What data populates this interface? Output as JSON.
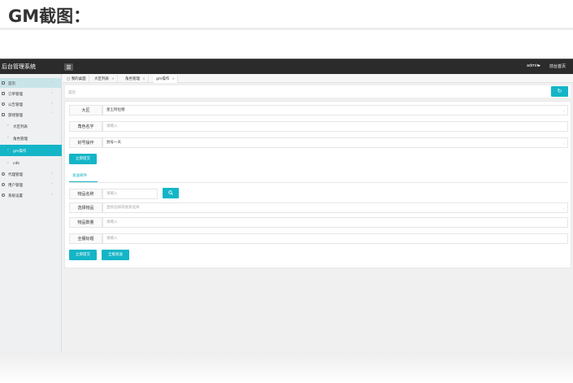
{
  "heading": "GM截图：",
  "app": {
    "brand": "后台管理系统",
    "user": "admin",
    "home_link": "前台首页"
  },
  "sidebar": {
    "items": [
      {
        "label": "首页",
        "icon": "home-icon"
      },
      {
        "label": "订单管理",
        "icon": "order-icon"
      },
      {
        "label": "公告管理",
        "icon": "notice-icon"
      },
      {
        "label": "游戏管理",
        "icon": "game-icon"
      },
      {
        "label": "大区列表"
      },
      {
        "label": "角色管理"
      },
      {
        "label": "gm操作"
      },
      {
        "label": "cdk"
      },
      {
        "label": "代理管理",
        "icon": "agent-icon"
      },
      {
        "label": "用户管理",
        "icon": "user-icon"
      },
      {
        "label": "系统设置",
        "icon": "settings-icon"
      }
    ]
  },
  "tabs": [
    {
      "label": "我的桌面"
    },
    {
      "label": "大区列表"
    },
    {
      "label": "角色管理"
    },
    {
      "label": "gm操作"
    }
  ],
  "breadcrumb": "首页",
  "form1": {
    "region_label": "大区",
    "region_value": "星尘阿拉德",
    "role_label": "角色名字",
    "role_placeholder": "请输入",
    "ban_label": "封号操作",
    "ban_value": "封号一天",
    "submit": "立即提交"
  },
  "mail_tab": "发送邮件",
  "form2": {
    "item_name_label": "物品名称",
    "item_name_placeholder": "请输入",
    "select_item_label": "选择物品",
    "select_item_placeholder": "直接选择或搜索选择",
    "qty_label": "物品数量",
    "qty_placeholder": "请输入",
    "title_label": "全服标题",
    "title_placeholder": "请输入",
    "submit": "立即提交",
    "send_all": "全服发送"
  },
  "colors": {
    "accent": "#14b5c7",
    "topbar": "#2b2b2b"
  }
}
